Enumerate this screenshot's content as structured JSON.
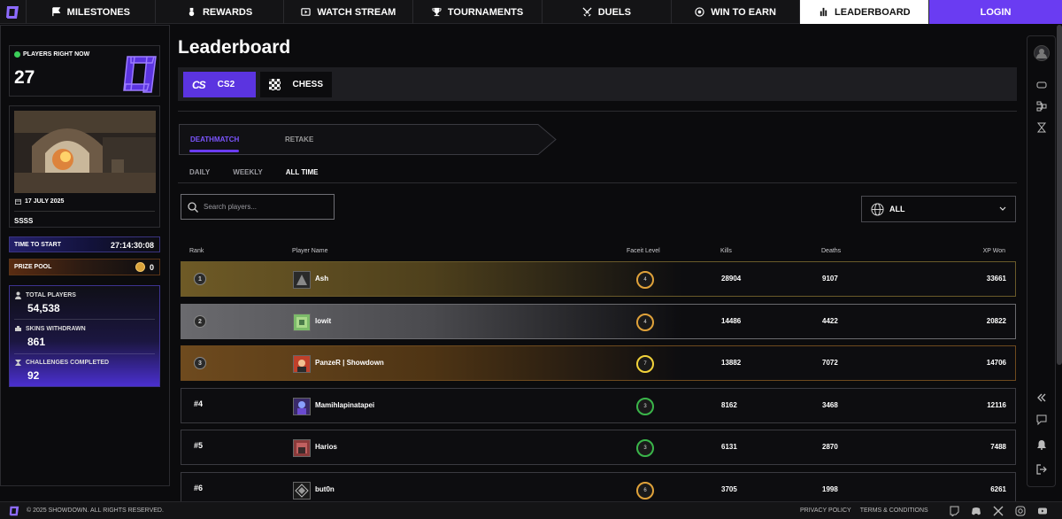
{
  "nav": {
    "items": [
      {
        "label": "MILESTONES",
        "icon": "flag-icon"
      },
      {
        "label": "REWARDS",
        "icon": "medal-icon"
      },
      {
        "label": "WATCH STREAM",
        "icon": "tv-icon"
      },
      {
        "label": "TOURNAMENTS",
        "icon": "trophy-icon"
      },
      {
        "label": "DUELS",
        "icon": "swords-icon"
      },
      {
        "label": "WIN TO EARN",
        "icon": "coin-icon"
      },
      {
        "label": "LEADERBOARD",
        "icon": "bar-chart-icon"
      }
    ],
    "login": "LOGIN"
  },
  "sidebar": {
    "players_label": "PLAYERS RIGHT NOW",
    "players_count": "27",
    "event_date": "17 JULY 2025",
    "event_title": "SSSS",
    "time_label": "TIME TO START",
    "time_value": "27:14:30:08",
    "prize_label": "PRIZE POOL",
    "prize_value": "0",
    "stats": [
      {
        "label": "TOTAL PLAYERS",
        "value": "54,538"
      },
      {
        "label": "SKINS WITHDRAWN",
        "value": "861"
      },
      {
        "label": "CHALLENGES COMPLETED",
        "value": "92"
      }
    ]
  },
  "main": {
    "title": "Leaderboard",
    "games": [
      {
        "mark": "CS",
        "label": "CS2"
      },
      {
        "label": "CHESS"
      }
    ],
    "modes": [
      "DEATHMATCH",
      "RETAKE"
    ],
    "periods": [
      "DAILY",
      "WEEKLY",
      "ALL TIME"
    ],
    "search_placeholder": "Search players...",
    "region": "ALL",
    "columns": [
      "Rank",
      "Player Name",
      "Faceit Level",
      "Kills",
      "Deaths",
      "XP Won"
    ],
    "rows": [
      {
        "rank": "1",
        "name": "Ash",
        "faceit": "4",
        "kills": "28904",
        "deaths": "9107",
        "xp": "33661"
      },
      {
        "rank": "2",
        "name": "lowit",
        "faceit": "4",
        "kills": "14486",
        "deaths": "4422",
        "xp": "20822"
      },
      {
        "rank": "3",
        "name": "PanzeR | Showdown",
        "faceit": "7",
        "kills": "13882",
        "deaths": "7072",
        "xp": "14706"
      },
      {
        "rank": "#4",
        "name": "Mamihlapinatapei",
        "faceit": "3",
        "kills": "8162",
        "deaths": "3468",
        "xp": "12116"
      },
      {
        "rank": "#5",
        "name": "Harios",
        "faceit": "3",
        "kills": "6131",
        "deaths": "2870",
        "xp": "7488"
      },
      {
        "rank": "#6",
        "name": "but0n",
        "faceit": "6",
        "kills": "3705",
        "deaths": "1998",
        "xp": "6261"
      }
    ]
  },
  "footer": {
    "copyright": "© 2025 SHOWDOWN. ALL RIGHTS RESERVED.",
    "privacy": "PRIVACY POLICY",
    "terms": "TERMS & CONDITIONS"
  },
  "colors": {
    "accent": "#6a3cf2",
    "gold": "#6e5a26",
    "silver": "#6a6a6e",
    "bronze": "#6e4a1e"
  }
}
